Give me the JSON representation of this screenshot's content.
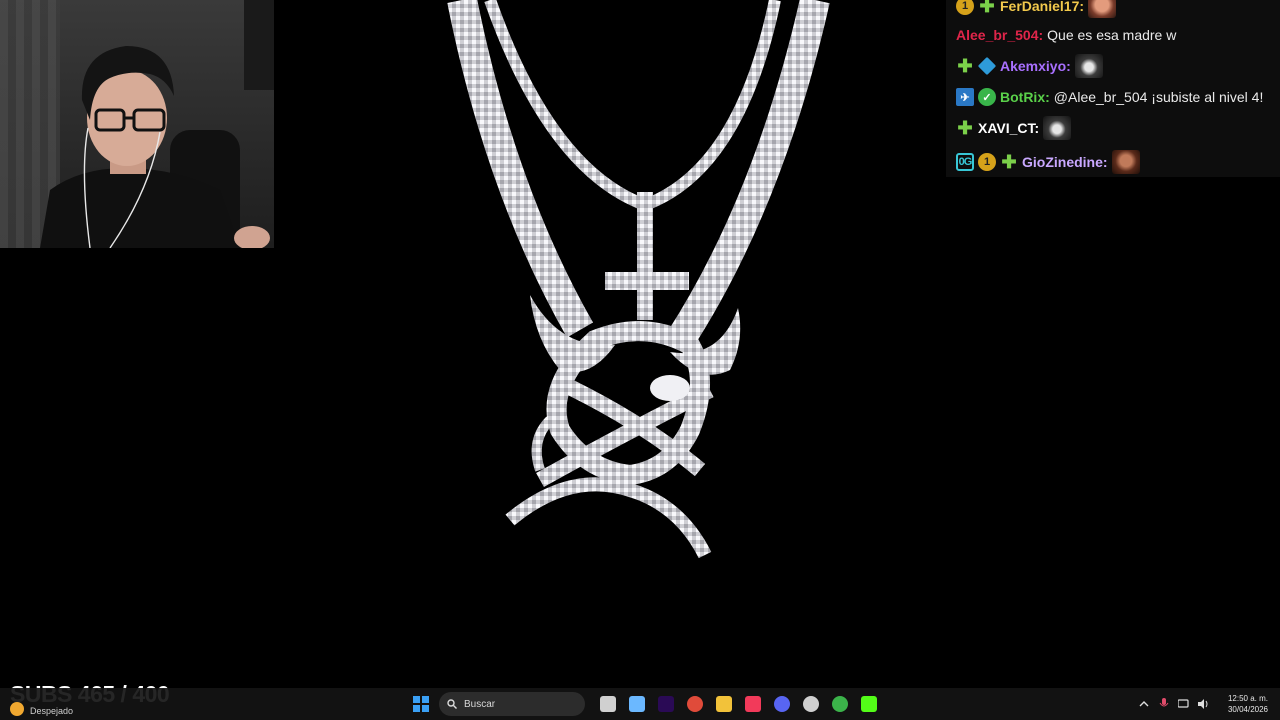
{
  "chat": {
    "messages": [
      {
        "user": "FerDaniel17:",
        "color": "#f2c94c",
        "badges": [
          "num-1",
          "gem"
        ],
        "text": "",
        "emote": "face1"
      },
      {
        "user": "Alee_br_504:",
        "color": "#e0254a",
        "badges": [],
        "text": "Que es esa madre w",
        "emote": ""
      },
      {
        "user": "Akemxiyo:",
        "color": "#a970ff",
        "badges": [
          "gem",
          "cube"
        ],
        "text": "",
        "emote": "cat"
      },
      {
        "user": "BotRix:",
        "color": "#5ad14a",
        "badges": [
          "bot",
          "verified"
        ],
        "text": "@Alee_br_504 ¡subiste al nivel 4!",
        "emote": ""
      },
      {
        "user": "XAVI_CT:",
        "color": "#ffffff",
        "badges": [
          "gem"
        ],
        "text": "",
        "emote": "cat"
      },
      {
        "user": "GioZinedine:",
        "color": "#c9a8ff",
        "badges": [
          "founder",
          "num-1",
          "gem"
        ],
        "text": "",
        "emote": "face2"
      }
    ],
    "badge_labels": {
      "num-1": "1",
      "founder": "0G",
      "bot": "✈",
      "verified": "✓",
      "gem": "✚"
    }
  },
  "subs": {
    "text": "SUBS 465 / 400"
  },
  "taskbar": {
    "weather_label": "Despejado",
    "search_placeholder": "Buscar",
    "apps": [
      {
        "name": "windows-start-icon",
        "color": "#3aa0f5"
      },
      {
        "name": "task-view-icon",
        "color": "#d0d0d0"
      },
      {
        "name": "copilot-icon",
        "color": "#6bb8ff"
      },
      {
        "name": "premiere-pro-icon",
        "color": "#2a0a55"
      },
      {
        "name": "chrome-icon",
        "color": "#e04b3a"
      },
      {
        "name": "file-explorer-icon",
        "color": "#f2c23a"
      },
      {
        "name": "apple-music-icon",
        "color": "#f23a5a"
      },
      {
        "name": "discord-icon",
        "color": "#5865f2"
      },
      {
        "name": "obs-icon",
        "color": "#cfcfcf"
      },
      {
        "name": "chrome-profile-icon",
        "color": "#3bb34a"
      },
      {
        "name": "kick-icon",
        "color": "#53fc18"
      }
    ],
    "clock_time": "12:50 a. m.",
    "clock_date": "30/04/2026",
    "tray_icons": [
      "chevron-up-icon",
      "microphone-icon",
      "network-icon",
      "volume-icon"
    ]
  }
}
